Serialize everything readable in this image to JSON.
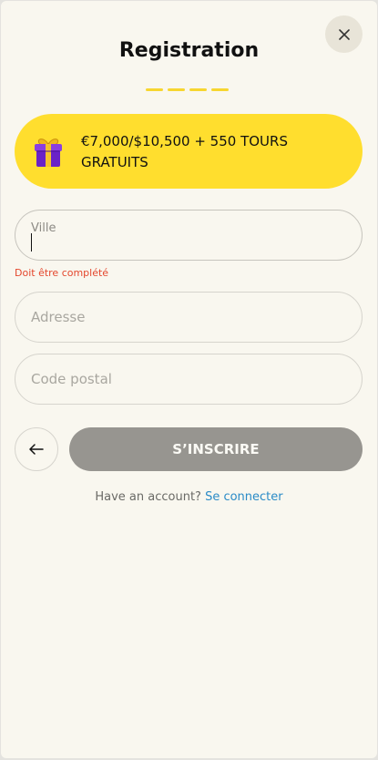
{
  "header": {
    "title": "Registration",
    "close_icon": "close-icon"
  },
  "promo": {
    "icon": "gift-icon",
    "text": "€7,000/$10,500 + 550 TOURS GRATUITS"
  },
  "form": {
    "city": {
      "label": "Ville",
      "value": "",
      "error": "Doit être complété"
    },
    "address": {
      "placeholder": "Adresse"
    },
    "postal_code": {
      "placeholder": "Code postal"
    }
  },
  "actions": {
    "back_icon": "arrow-left-icon",
    "submit_label": "S’INSCRIRE"
  },
  "footer": {
    "prompt": "Have an account?",
    "login_link": "Se connecter"
  },
  "colors": {
    "background": "#f9f7ef",
    "accent_yellow": "#ffde2e",
    "submit_disabled": "#979590",
    "error": "#e4472d",
    "link": "#2a8bc7"
  }
}
